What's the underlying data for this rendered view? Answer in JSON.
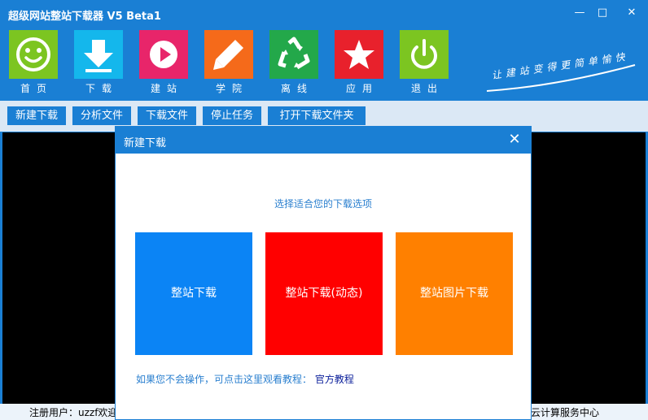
{
  "window": {
    "title": "超级网站整站下载器 V5 Beta1",
    "minimize_glyph": "—",
    "maximize_glyph": "□",
    "close_glyph": "✕"
  },
  "nav": {
    "items": [
      {
        "label": "首页",
        "color": "#7cc521",
        "icon": "smiley-icon"
      },
      {
        "label": "下载",
        "color": "#14b7ec",
        "icon": "download-arrow-icon"
      },
      {
        "label": "建站",
        "color": "#e8256a",
        "icon": "play-icon"
      },
      {
        "label": "学院",
        "color": "#f56a1a",
        "icon": "pencil-icon"
      },
      {
        "label": "离线",
        "color": "#23a84a",
        "icon": "recycle-icon"
      },
      {
        "label": "应用",
        "color": "#e8212c",
        "icon": "star-icon"
      },
      {
        "label": "退出",
        "color": "#7cc521",
        "icon": "power-icon"
      }
    ],
    "slogan": "让建站变得更简单愉快"
  },
  "toolbar": {
    "buttons": [
      "新建下载",
      "分析文件",
      "下载文件",
      "停止任务",
      "打开下载文件夹"
    ]
  },
  "status": {
    "left": "注册用户：uzzf欢迎",
    "right": "云计算服务中心"
  },
  "dialog": {
    "title": "新建下载",
    "close_glyph": "✕",
    "prompt": "选择适合您的下载选项",
    "options": [
      {
        "label": "整站下载",
        "color": "#0b84f5"
      },
      {
        "label": "整站下载(动态)",
        "color": "#ff0000"
      },
      {
        "label": "整站图片下载",
        "color": "#ff8000"
      }
    ],
    "hint": "如果您不会操作，可点击这里观看教程：",
    "link": "官方教程"
  },
  "colors": {
    "accent": "#1a7fd4",
    "toolbar_bg": "#dbe8f5"
  }
}
